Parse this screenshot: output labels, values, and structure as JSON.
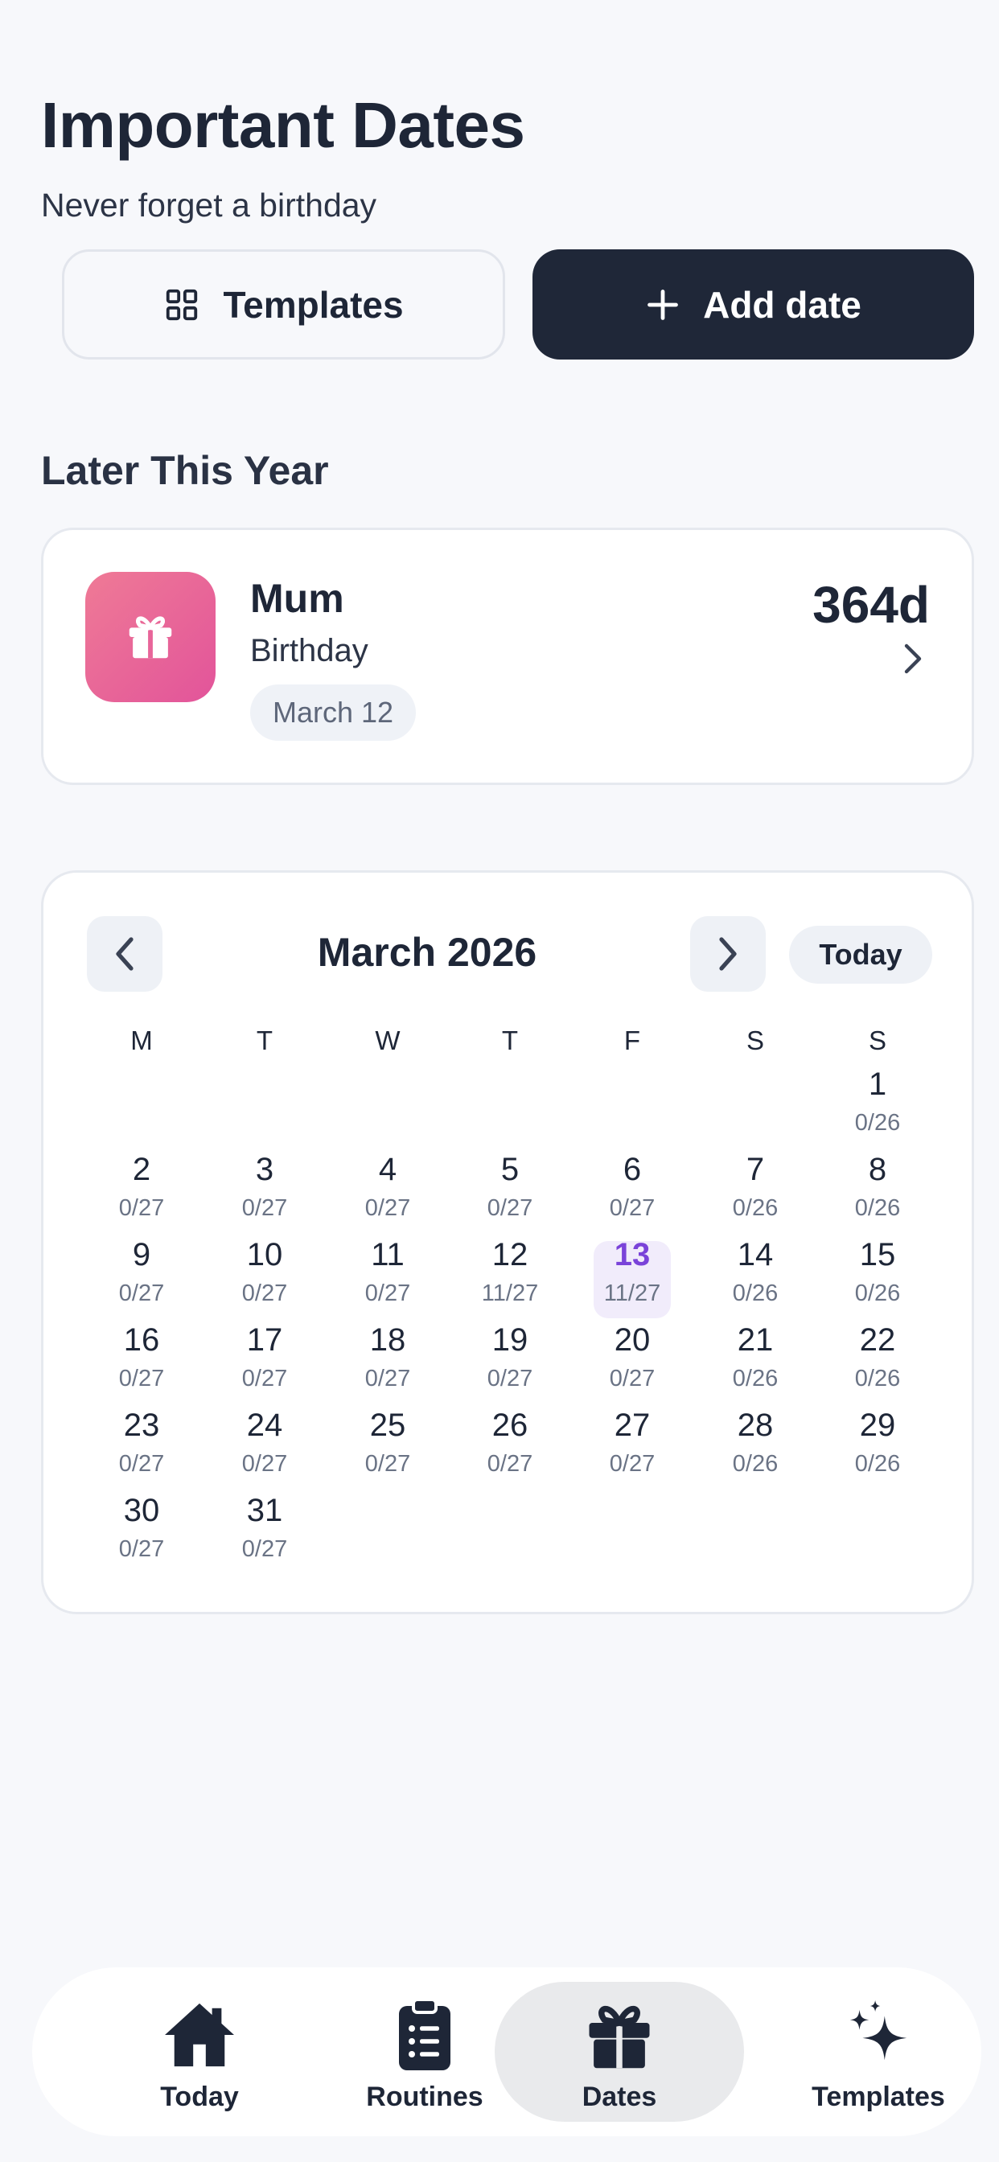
{
  "header": {
    "title": "Important Dates",
    "subtitle": "Never forget a birthday"
  },
  "actions": {
    "templates_label": "Templates",
    "add_label": "Add date"
  },
  "section": {
    "title": "Later This Year"
  },
  "upcoming": [
    {
      "name": "Mum",
      "type": "Birthday",
      "date": "March 12",
      "days_left": "364d",
      "icon": "gift-icon",
      "colors": [
        "#ef7a96",
        "#e2549a"
      ]
    }
  ],
  "calendar": {
    "month_label": "March 2026",
    "today_label": "Today",
    "weekdays": [
      "M",
      "T",
      "W",
      "T",
      "F",
      "S",
      "S"
    ],
    "selected_day": "13",
    "selected_color": "#7a43d9",
    "days": [
      {
        "d": "1",
        "c": "0/26"
      },
      {
        "d": "2",
        "c": "0/27"
      },
      {
        "d": "3",
        "c": "0/27"
      },
      {
        "d": "4",
        "c": "0/27"
      },
      {
        "d": "5",
        "c": "0/27"
      },
      {
        "d": "6",
        "c": "0/27"
      },
      {
        "d": "7",
        "c": "0/26"
      },
      {
        "d": "8",
        "c": "0/26"
      },
      {
        "d": "9",
        "c": "0/27"
      },
      {
        "d": "10",
        "c": "0/27"
      },
      {
        "d": "11",
        "c": "0/27"
      },
      {
        "d": "12",
        "c": "11/27"
      },
      {
        "d": "13",
        "c": "11/27"
      },
      {
        "d": "14",
        "c": "0/26"
      },
      {
        "d": "15",
        "c": "0/26"
      },
      {
        "d": "16",
        "c": "0/27"
      },
      {
        "d": "17",
        "c": "0/27"
      },
      {
        "d": "18",
        "c": "0/27"
      },
      {
        "d": "19",
        "c": "0/27"
      },
      {
        "d": "20",
        "c": "0/27"
      },
      {
        "d": "21",
        "c": "0/26"
      },
      {
        "d": "22",
        "c": "0/26"
      },
      {
        "d": "23",
        "c": "0/27"
      },
      {
        "d": "24",
        "c": "0/27"
      },
      {
        "d": "25",
        "c": "0/27"
      },
      {
        "d": "26",
        "c": "0/27"
      },
      {
        "d": "27",
        "c": "0/27"
      },
      {
        "d": "28",
        "c": "0/26"
      },
      {
        "d": "29",
        "c": "0/26"
      },
      {
        "d": "30",
        "c": "0/27"
      },
      {
        "d": "31",
        "c": "0/27"
      }
    ]
  },
  "tabbar": {
    "items": [
      {
        "label": "Today",
        "icon": "home-icon",
        "active": false
      },
      {
        "label": "Routines",
        "icon": "clipboard-list-icon",
        "active": false
      },
      {
        "label": "Dates",
        "icon": "gift-icon",
        "active": true
      },
      {
        "label": "Templates",
        "icon": "sparkles-icon",
        "active": false
      }
    ]
  },
  "colors": {
    "primary_dark": "#1f2738",
    "background": "#f7f8fb",
    "accent_purple": "#7a43d9"
  }
}
